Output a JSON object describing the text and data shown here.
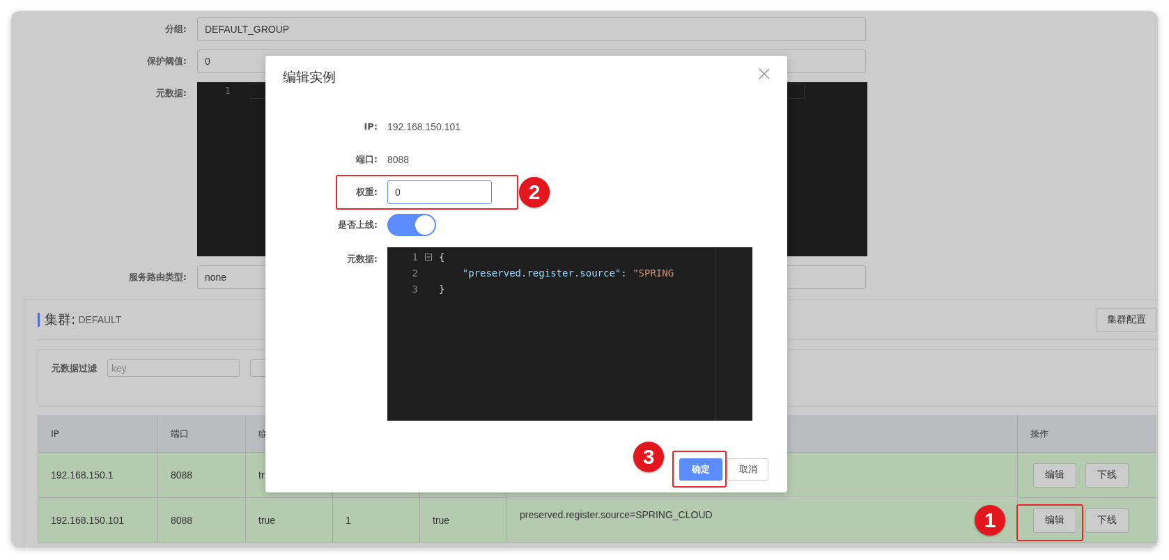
{
  "form": [
    {
      "label": "分组:",
      "kind": "input",
      "value": "DEFAULT_GROUP"
    },
    {
      "label": "保护阈值:",
      "kind": "input",
      "value": "0"
    },
    {
      "label": "元数据:",
      "kind": "editor",
      "line_numbers": [
        "1"
      ]
    },
    {
      "label": "服务路由类型:",
      "kind": "input",
      "value": "none"
    }
  ],
  "cluster": {
    "label": "集群:",
    "name": "DEFAULT",
    "config_button": "集群配置",
    "filter": {
      "label": "元数据过滤",
      "placeholder": "key"
    },
    "table": {
      "headers": [
        "IP",
        "端口",
        "临"
      ],
      "actions_header": "操作",
      "rows": [
        {
          "cells": [
            "192.168.150.1",
            "8088",
            "tr"
          ],
          "actions": [
            {
              "label": "编辑"
            },
            {
              "label": "下线"
            }
          ]
        },
        {
          "cells": [
            "192.168.150.101",
            "8088",
            "true",
            "1",
            "true",
            "preserved.register.source=SPRING_CLOUD"
          ],
          "actions": [
            {
              "label": "编辑",
              "callout": "1"
            },
            {
              "label": "下线"
            }
          ]
        }
      ]
    }
  },
  "dialog": {
    "title": "编辑实例",
    "fields": [
      {
        "label": "IP:",
        "kind": "text",
        "value": "192.168.150.101"
      },
      {
        "label": "端口:",
        "kind": "text",
        "value": "8088"
      },
      {
        "label": "权重:",
        "kind": "input",
        "value": "0",
        "callout": "2"
      },
      {
        "label": "是否上线:",
        "kind": "switch",
        "on": true
      },
      {
        "label": "元数据:",
        "kind": "editor",
        "lines": [
          {
            "number": "1",
            "fold": true,
            "tokens": [
              {
                "kind": "punct",
                "text": "{"
              }
            ]
          },
          {
            "number": "2",
            "fold": false,
            "tokens": [
              {
                "kind": "key",
                "text": "    \"preserved.register.source\""
              },
              {
                "kind": "punct",
                "text": ": "
              },
              {
                "kind": "string",
                "text": "\"SPRING"
              }
            ]
          },
          {
            "number": "3",
            "fold": false,
            "tokens": [
              {
                "kind": "punct",
                "text": "}"
              }
            ]
          }
        ]
      }
    ],
    "confirm": {
      "label": "确定",
      "callout": "3"
    },
    "cancel": {
      "label": "取消"
    }
  }
}
